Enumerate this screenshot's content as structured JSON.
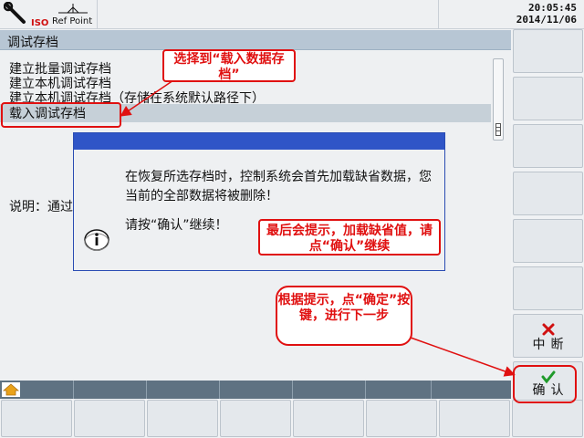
{
  "header": {
    "ref_point_label": "Ref Point",
    "time": "20:05:45",
    "date": "2014/11/06",
    "iso_label": "ISO"
  },
  "title": "调试存档",
  "menu_items": [
    "建立批量调试存档",
    "建立本机调试存档",
    "建立本机调试存档（存储在系统默认路径下）",
    "载入调试存档"
  ],
  "description_label": "说明：通过",
  "dialog": {
    "message": "在恢复所选存档时，控制系统会首先加载缺省数据，您当前的全部数据将被删除！",
    "prompt": "请按“确认”继续！"
  },
  "annotations": {
    "select_hint": "选择到“载入数据存档”",
    "dialog_hint": "最后会提示，加载缺省值，请点“确认”继续",
    "confirm_hint": "根据提示，点“确定”按键，进行下一步"
  },
  "softkeys": {
    "abort": "中断",
    "confirm": "确认"
  },
  "colors": {
    "annotation_red": "#e01010",
    "dialog_blue": "#2f55c7",
    "confirm_green": "#1f9a2a"
  }
}
